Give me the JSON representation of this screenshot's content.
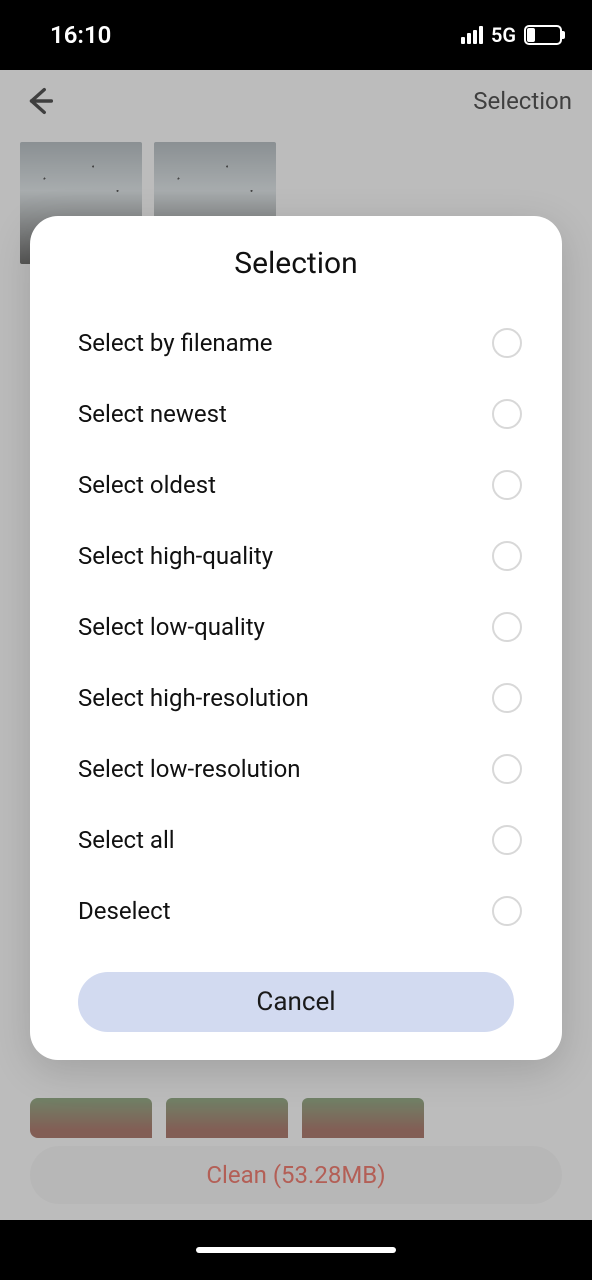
{
  "status": {
    "time": "16:10",
    "network": "5G",
    "battery": "22"
  },
  "header": {
    "title": "Selection"
  },
  "modal": {
    "title": "Selection",
    "cancel": "Cancel",
    "options": [
      {
        "label": "Select by filename"
      },
      {
        "label": "Select newest"
      },
      {
        "label": "Select oldest"
      },
      {
        "label": "Select high-quality"
      },
      {
        "label": "Select low-quality"
      },
      {
        "label": "Select high-resolution"
      },
      {
        "label": "Select low-resolution"
      },
      {
        "label": "Select all"
      },
      {
        "label": "Deselect"
      }
    ]
  },
  "footer": {
    "clean_label": "Clean (53.28MB)"
  }
}
